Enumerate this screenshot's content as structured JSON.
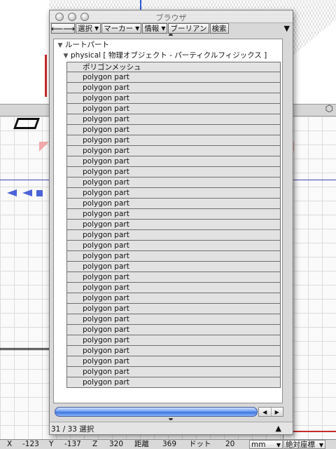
{
  "window": {
    "title": "ブラウザ"
  },
  "toolbar": {
    "nav_arrows": "⟵⟶",
    "buttons": [
      {
        "label": "選択",
        "dropdown": true
      },
      {
        "label": "マーカー",
        "dropdown": true
      },
      {
        "label": "情報",
        "dropdown": true
      },
      {
        "label": "ブーリアン",
        "dropdown": false
      },
      {
        "label": "検索",
        "dropdown": false
      }
    ],
    "menu_glyph": "▼"
  },
  "tree": {
    "root_label": "ルートパート",
    "physical_label": "physical [ 物理オブジェクト - パーティクルフィジックス ]",
    "items": [
      "ポリゴンメッシュ",
      "polygon part",
      "polygon part",
      "polygon part",
      "polygon part",
      "polygon part",
      "polygon part",
      "polygon part",
      "polygon part",
      "polygon part",
      "polygon part",
      "polygon part",
      "polygon part",
      "polygon part",
      "polygon part",
      "polygon part",
      "polygon part",
      "polygon part",
      "polygon part",
      "polygon part",
      "polygon part",
      "polygon part",
      "polygon part",
      "polygon part",
      "polygon part",
      "polygon part",
      "polygon part",
      "polygon part",
      "polygon part",
      "polygon part",
      "polygon part"
    ]
  },
  "status": {
    "selection": "31 / 33 選択",
    "triangle": "▲"
  },
  "coordbar": {
    "x_label": "X",
    "x_value": "-123",
    "y_label": "Y",
    "y_value": "-137",
    "z_label": "Z",
    "z_value": "320",
    "distance_label": "距離",
    "distance_value": "369",
    "dot_label": "ドット",
    "dot_value": "20",
    "unit": "mm",
    "coord_mode": "絶対座標"
  },
  "colors": {
    "scrollbar_blue": "#3e74dc",
    "row_bg": "#e2e2e2",
    "viewport_grid": "#dcdcdc"
  }
}
